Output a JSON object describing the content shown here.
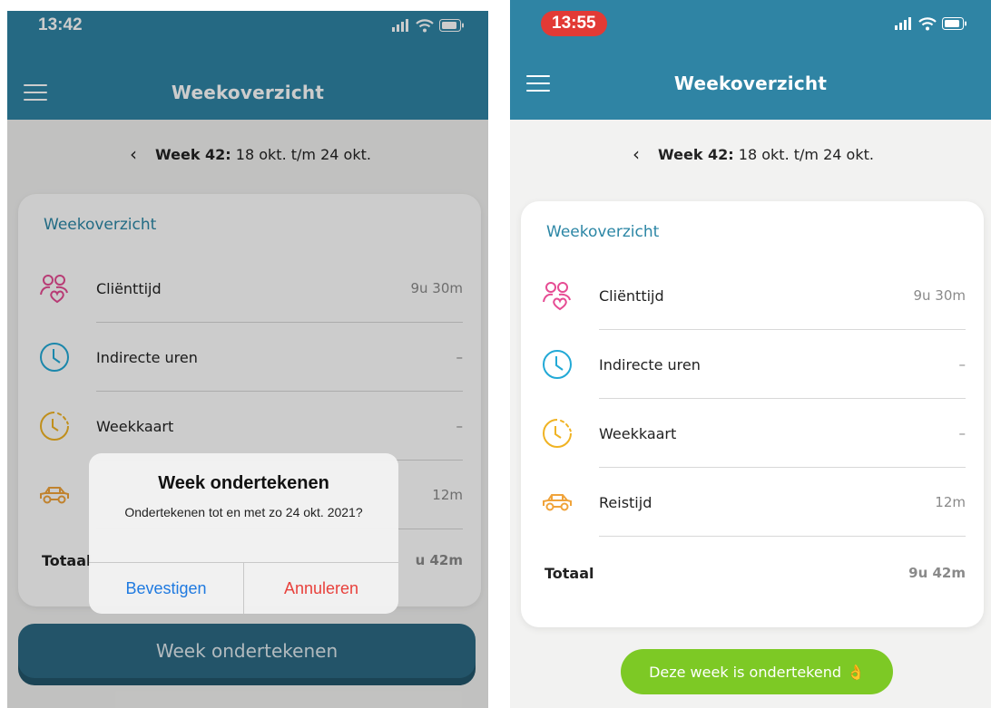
{
  "left": {
    "status": {
      "time": "13:42"
    },
    "nav": {
      "title": "Weekoverzicht"
    },
    "week": {
      "label": "Week 42:",
      "range": "18 okt. t/m 24 okt."
    },
    "card": {
      "title": "Weekoverzicht",
      "rows": [
        {
          "label": "Cliënttijd",
          "value": "9u 30m",
          "icon": "clients-heart-icon"
        },
        {
          "label": "Indirecte uren",
          "value": "–",
          "icon": "clock-icon"
        },
        {
          "label": "Weekkaart",
          "value": "–",
          "icon": "timer-clock-icon"
        },
        {
          "label": "",
          "value": "12m",
          "icon": "car-icon"
        }
      ],
      "total": {
        "label": "Totaal",
        "value": "u 42m"
      }
    },
    "dialog": {
      "title": "Week ondertekenen",
      "message": "Ondertekenen tot en met zo 24 okt. 2021?",
      "confirm": "Bevestigen",
      "cancel": "Annuleren"
    },
    "sign_button": "Week ondertekenen"
  },
  "right": {
    "status": {
      "time": "13:55"
    },
    "nav": {
      "title": "Weekoverzicht"
    },
    "week": {
      "label": "Week 42:",
      "range": "18 okt. t/m 24 okt."
    },
    "card": {
      "title": "Weekoverzicht",
      "rows": [
        {
          "label": "Cliënttijd",
          "value": "9u 30m",
          "icon": "clients-heart-icon"
        },
        {
          "label": "Indirecte uren",
          "value": "–",
          "icon": "clock-icon"
        },
        {
          "label": "Weekkaart",
          "value": "–",
          "icon": "timer-clock-icon"
        },
        {
          "label": "Reistijd",
          "value": "12m",
          "icon": "car-icon"
        }
      ],
      "total": {
        "label": "Totaal",
        "value": "9u 42m"
      }
    },
    "signed_badge": {
      "text": "Deze week is ondertekend",
      "emoji": "👌"
    }
  },
  "colors": {
    "nav_bar": "#2f84a4",
    "accent_title": "#2b86a5",
    "clients_icon": "#e64c93",
    "clock_icon": "#22a9d6",
    "timer_icon": "#f0b323",
    "car_icon": "#f0a33a",
    "sign_button": "#2c6a84",
    "signed_badge": "#7dc925",
    "confirm": "#1f7ae0",
    "cancel": "#e8413c"
  }
}
